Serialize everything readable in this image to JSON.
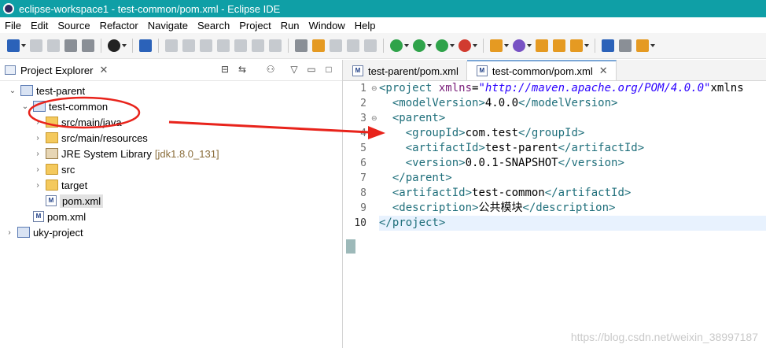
{
  "window": {
    "title": "eclipse-workspace1 - test-common/pom.xml - Eclipse IDE"
  },
  "menu": [
    "File",
    "Edit",
    "Source",
    "Refactor",
    "Navigate",
    "Search",
    "Project",
    "Run",
    "Window",
    "Help"
  ],
  "project_explorer": {
    "title": "Project Explorer",
    "close": "✕",
    "tree": [
      {
        "label": "test-parent",
        "depth": 0,
        "expanded": true,
        "icon": "project-icon"
      },
      {
        "label": "test-common",
        "depth": 1,
        "expanded": true,
        "icon": "project-icon"
      },
      {
        "label": "src/main/java",
        "depth": 2,
        "expanded": false,
        "icon": "source-folder-icon"
      },
      {
        "label": "src/main/resources",
        "depth": 2,
        "expanded": false,
        "icon": "source-folder-icon"
      },
      {
        "label": "JRE System Library",
        "suffix": "[jdk1.8.0_131]",
        "depth": 2,
        "expanded": false,
        "icon": "library-icon"
      },
      {
        "label": "src",
        "depth": 2,
        "expanded": false,
        "icon": "folder-icon"
      },
      {
        "label": "target",
        "depth": 2,
        "expanded": false,
        "icon": "folder-icon"
      },
      {
        "label": "pom.xml",
        "depth": 2,
        "icon": "xml-file-icon"
      },
      {
        "label": "pom.xml",
        "depth": 1,
        "icon": "xml-file-icon"
      },
      {
        "label": "uky-project",
        "depth": 0,
        "expanded": false,
        "icon": "project-icon"
      }
    ]
  },
  "editor": {
    "tabs": [
      {
        "label": "test-parent/pom.xml",
        "active": false
      },
      {
        "label": "test-common/pom.xml",
        "active": true,
        "close": "✕"
      }
    ],
    "line_numbers": [
      "1",
      "2",
      "3",
      "4",
      "5",
      "6",
      "7",
      "8",
      "9",
      "10"
    ],
    "lines": [
      "<project xmlns=\"http://maven.apache.org/POM/4.0.0\" xmlns",
      "  <modelVersion>4.0.0</modelVersion>",
      "  <parent>",
      "    <groupId>com.test</groupId>",
      "    <artifactId>test-parent</artifactId>",
      "    <version>0.0.1-SNAPSHOT</version>",
      "  </parent>",
      "  <artifactId>test-common</artifactId>",
      "  <description>公共模块</description>",
      "</project>"
    ]
  },
  "watermark": "https://blog.csdn.net/weixin_38997187",
  "colors": {
    "titlebar": "#0f9fa6",
    "annotation": "#e8231b"
  }
}
